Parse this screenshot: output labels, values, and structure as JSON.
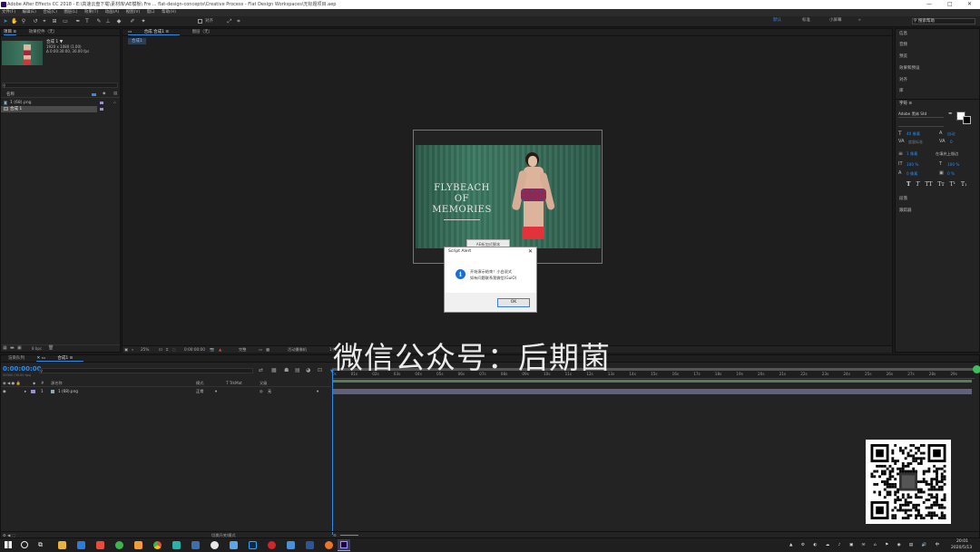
{
  "titlebar": {
    "text": "Adobe After Effects CC 2018 - E:\\高速云盘下载\\素材库\\AE模板\\ Fre ... flat-design-concepts\\Creative Process - Flat Design Workspaces\\无标题项目.aep"
  },
  "menubar": {
    "items": [
      "文件(F)",
      "编辑(E)",
      "合成(C)",
      "图层(L)",
      "效果(T)",
      "动画(A)",
      "视图(V)",
      "窗口",
      "帮助(H)"
    ]
  },
  "toolbar": {
    "snap_label": "对齐",
    "workspaces": [
      "默认",
      "标准",
      "小屏幕"
    ],
    "search_placeholder": "搜索帮助"
  },
  "project_panel": {
    "tabs": [
      "项目 ≡",
      "效果控件（无）"
    ],
    "comp_name": "合成 1 ▼",
    "comp_info1": "1920 x 1080 (1.00)",
    "comp_info2": "Δ 0:00:30:00, 30.00 fps",
    "name_header": "名称",
    "items": [
      "1 (68).png",
      "合成 1"
    ],
    "bpc": "8 bpc"
  },
  "comp_panel": {
    "tabs": [
      "合成 合成1 ≡",
      "图层（无）"
    ],
    "breadcrumb": "合成1",
    "image_text": [
      "FLYBEACH",
      "OF",
      "MEMORIES"
    ],
    "tooltip": "AE新加式脚本",
    "zoom": "25%",
    "timecode": "0:00:00:00",
    "quality": "完整",
    "camera": "活动摄像机",
    "views": "1个..."
  },
  "dialog": {
    "title": "Script Alert",
    "line1": "开始演示结束！小白说式",
    "line2": "如有问题联系我微信(GuiO)",
    "ok_label": "OK"
  },
  "watermark": "微信公众号：后期菌",
  "right_panel": {
    "items": [
      "信息",
      "音频",
      "预览",
      "效果和预设",
      "对齐",
      "库"
    ],
    "char_title": "字符 ≡",
    "font_name": "Adobe 黑体 Std",
    "font_size": "40 像素",
    "leading": "自动",
    "tracking": "度量标准",
    "tracking_val": "0",
    "stroke": "1 像素",
    "stroke_mode": "在填充上描边",
    "vscale": "100 %",
    "hscale": "100 %",
    "baseline": "0 像素",
    "tsume": "0 %",
    "style_buttons": [
      "T",
      "T",
      "TT",
      "Tт",
      "T¹",
      "T₁"
    ],
    "after": [
      "段落",
      "跟踪器"
    ]
  },
  "timeline": {
    "tabs": [
      "渲染队列",
      "合成1 ≡"
    ],
    "timecode": "0:00:00:00",
    "timecode_sub": "00000 (30.00 fps)",
    "col_source": "源名称",
    "col_mode": "模式",
    "col_trkmat": "T  TrkMat",
    "col_parent": "父级",
    "layer_num": "1",
    "layer_name": "1 (68).png",
    "layer_mode": "正常",
    "layer_parent": "无",
    "ruler": [
      "0s",
      "01s",
      "02s",
      "03s",
      "04s",
      "05s",
      "06s",
      "07s",
      "08s",
      "09s",
      "10s",
      "11s",
      "12s",
      "13s",
      "14s",
      "15s",
      "16s",
      "17s",
      "18s",
      "19s",
      "20s",
      "21s",
      "22s",
      "23s",
      "24s",
      "25s",
      "26s",
      "27s",
      "28s",
      "29s"
    ],
    "footer": "切换开关/模式"
  },
  "taskbar": {
    "time": "20:01",
    "date": "2020/5/13"
  }
}
